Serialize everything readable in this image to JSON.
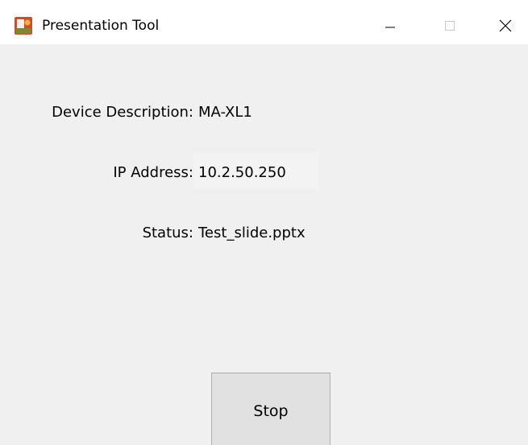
{
  "window": {
    "title": "Presentation Tool",
    "icon": "presentation-app-icon",
    "controls": {
      "minimize": "minimize-icon",
      "maximize": "maximize-icon",
      "close": "close-icon"
    }
  },
  "fields": {
    "device_description": {
      "label": "Device Description:",
      "value": "MA-XL1"
    },
    "ip_address": {
      "label": "IP Address:",
      "value": "10.2.50.250"
    },
    "status": {
      "label": "Status:",
      "value": "Test_slide.pptx"
    }
  },
  "actions": {
    "stop_label": "Stop"
  },
  "colors": {
    "window_bg": "#f0f0f0",
    "titlebar_bg": "#ffffff",
    "button_bg": "#e1e1e1",
    "button_border": "#adadad"
  }
}
